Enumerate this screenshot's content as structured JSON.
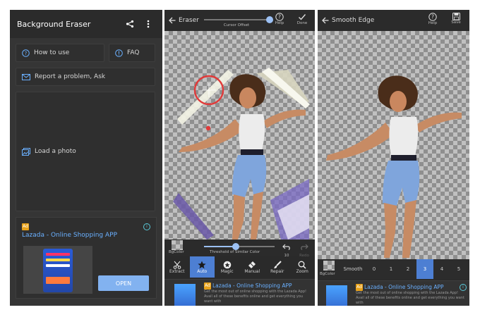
{
  "panel1": {
    "title": "Background Eraser",
    "icons": {
      "share": "share-icon",
      "more": "more-vertical-icon"
    },
    "how_to_use": "How to use",
    "faq": "FAQ",
    "report": "Report a problem, Ask",
    "load_photo": "Load a photo",
    "ad": {
      "badge": "Ad",
      "title": "Lazada - Online Shopping APP",
      "open": "OPEN"
    }
  },
  "panel2": {
    "title": "Eraser",
    "cursor_offset": "Cursor Offset",
    "help": "Help",
    "done": "Done",
    "bgcolor": "BgColor",
    "threshold": "Threshold of Similar Color",
    "undo_count": "10",
    "redo": "Redo",
    "tools": [
      {
        "label": "Extract",
        "icon": "scissors-icon"
      },
      {
        "label": "Auto",
        "icon": "star-icon",
        "active": true
      },
      {
        "label": "Magic",
        "icon": "magic-star-icon"
      },
      {
        "label": "Manual",
        "icon": "eraser-icon"
      },
      {
        "label": "Repair",
        "icon": "brush-icon"
      },
      {
        "label": "Zoom",
        "icon": "search-icon"
      }
    ],
    "ad": {
      "badge": "Ad",
      "title": "Lazada - Online Shopping APP",
      "desc": "Get the most out of online shopping with the Lazada App! Avail all of these benefits online and get everything you want with"
    }
  },
  "panel3": {
    "title": "Smooth Edge",
    "help": "Help",
    "save": "Save",
    "bgcolor": "BgColor",
    "smooth_label": "Smooth",
    "smooth_values": [
      "0",
      "1",
      "2",
      "3",
      "4",
      "5"
    ],
    "selected": "3",
    "ad": {
      "badge": "Ad",
      "title": "Lazada - Online Shopping APP",
      "desc": "Get the most out of online shopping with the Lazada App! Avail all of these benefits online and get everything you want with"
    }
  },
  "colors": {
    "accent": "#4d7fd3",
    "ad_link": "#6ab0ff",
    "open_btn": "#82b2f0",
    "dark": "#2b2b2b"
  }
}
